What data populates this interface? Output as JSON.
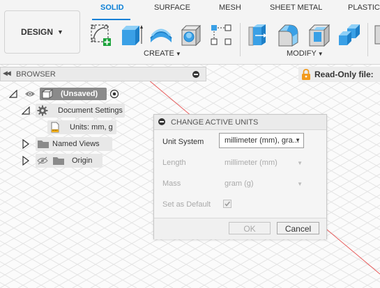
{
  "toolbar": {
    "workspace": "DESIGN",
    "tabs": [
      "SOLID",
      "SURFACE",
      "MESH",
      "SHEET METAL",
      "PLASTIC"
    ],
    "active_tab": "SOLID",
    "groups": {
      "create": "CREATE",
      "modify": "MODIFY"
    },
    "accent_color": "#0b7fd6"
  },
  "browser": {
    "title": "BROWSER",
    "root": "(Unsaved)",
    "items": {
      "document_settings": "Document Settings",
      "units": "Units: mm, g",
      "named_views": "Named Views",
      "origin": "Origin"
    }
  },
  "readonly": {
    "label": "Read-Only file:"
  },
  "dialog": {
    "title": "CHANGE ACTIVE UNITS",
    "unit_system_label": "Unit System",
    "unit_system_value": "millimeter (mm), gra...",
    "length_label": "Length",
    "length_value": "millimeter (mm)",
    "mass_label": "Mass",
    "mass_value": "gram (g)",
    "default_label": "Set as Default",
    "set_as_default": true,
    "ok": "OK",
    "cancel": "Cancel"
  }
}
